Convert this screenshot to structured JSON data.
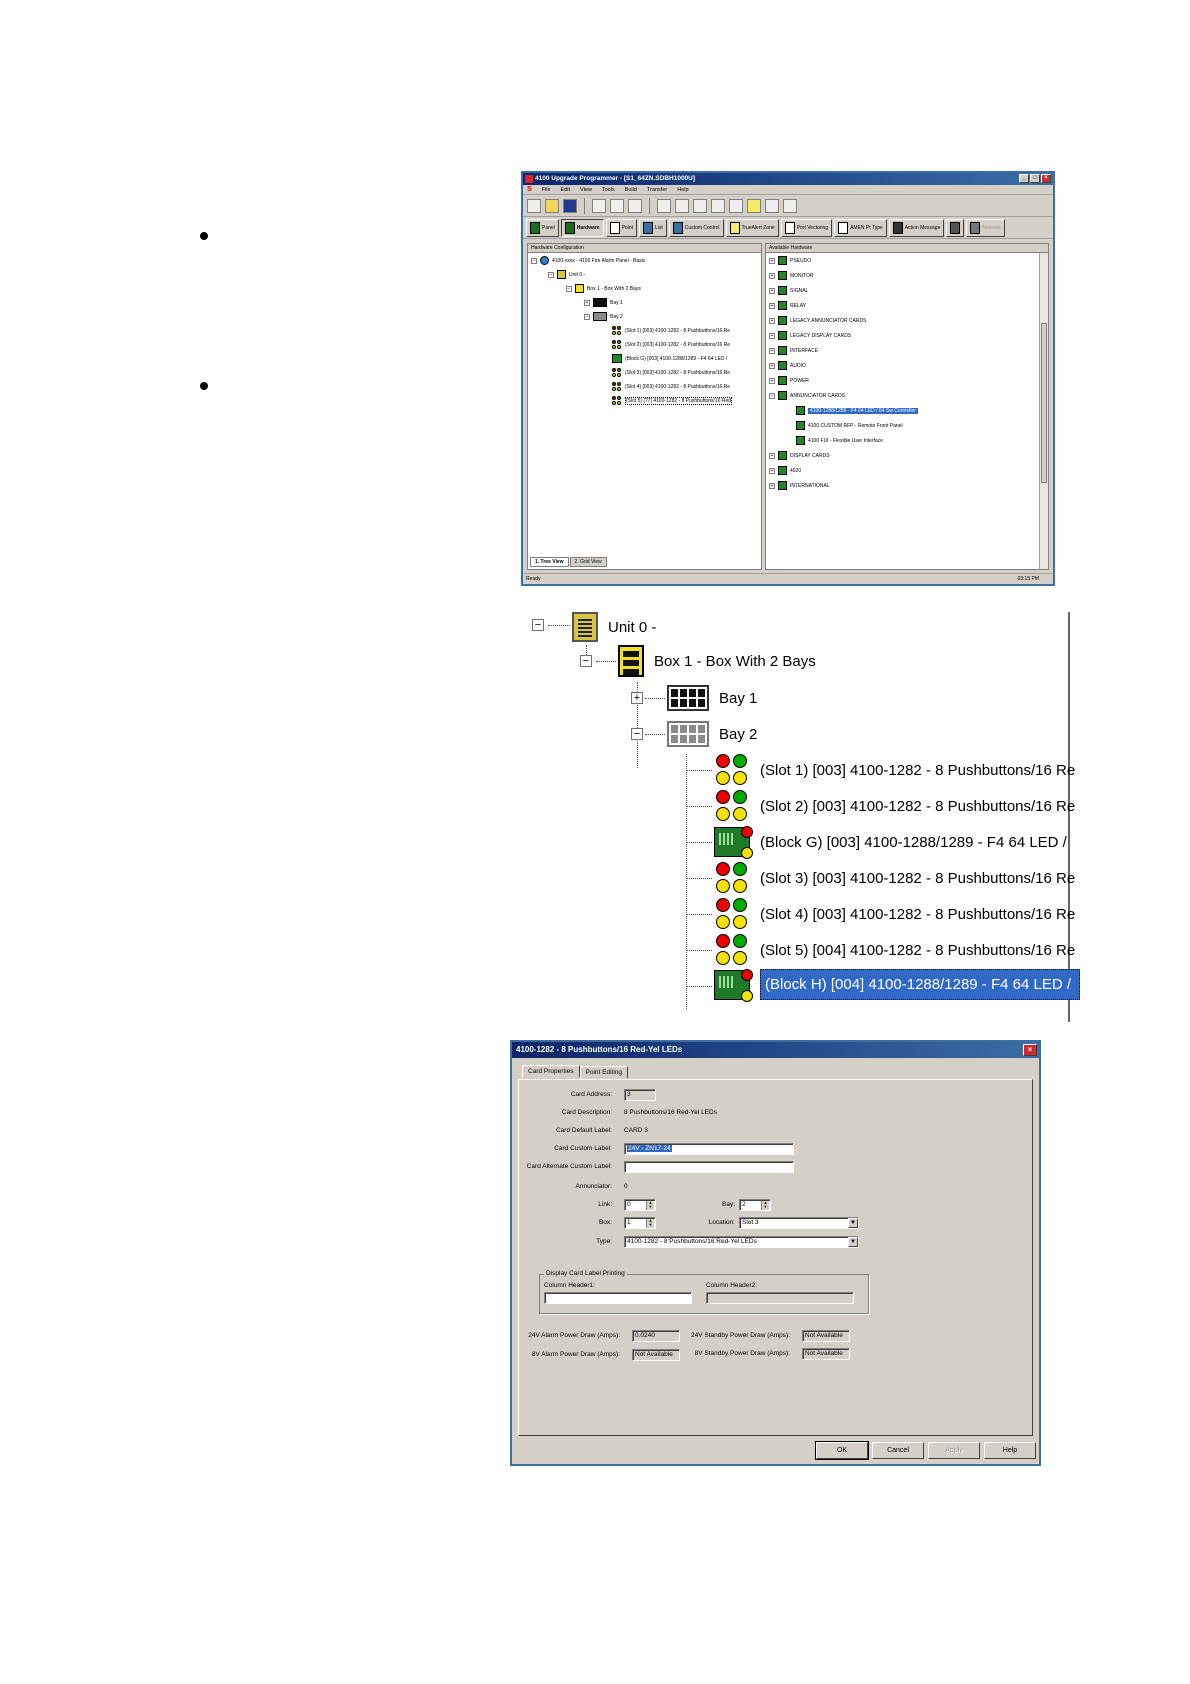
{
  "window": {
    "title": "4100 Upgrade Programmer - [S1_64ZN.SDBH1000U]",
    "menu": [
      "File",
      "Edit",
      "View",
      "Tools",
      "Build",
      "Transfer",
      "Help"
    ],
    "tabs": [
      "Panel",
      "Hardware",
      "Point",
      "List",
      "Custom Control",
      "TrueAlert Zone",
      "Port Vectoring",
      "AMEN Pt Type",
      "Action Message"
    ],
    "disabled_tab": "Network",
    "hw_header": "Hardware Configuration",
    "av_header": "Available Hardware",
    "hw_tree": {
      "root": "4100-xxxx - 4100 Fire Alarm Panel - Basic",
      "unit": "Unit 0 -",
      "box": "Box 1 - Box With 2 Bays",
      "bay1": "Bay 1",
      "bay2": "Bay 2",
      "slots": [
        "(Slot 1) [003] 4100-1282 - 8 Pushbuttons/16 Re",
        "(Slot 2) [003] 4100-1282 - 8 Pushbuttons/16 Re",
        "(Block G) [003] 4100-1288/1289 - F4 64 LED /",
        "(Slot 3) [003] 4100-1282 - 8 Pushbuttons/16 Re",
        "(Slot 4) [003] 4100-1282 - 8 Pushbuttons/16 Re",
        "(Slot 5) [?7] 4100-1282 - 8 Pushbuttons/16 Red"
      ]
    },
    "available": [
      "PSEUDO",
      "MONITOR",
      "SIGNAL",
      "RELAY",
      "LEGACY ANNUNCIATOR CARDS",
      "LEGACY DISPLAY CARDS",
      "INTERFACE",
      "AUDIO",
      "POWER",
      "ANNUNCIATOR CARDS"
    ],
    "available_children": [
      "4100-1288/1289 - F4 64 LED / 64 Sw Controller",
      "4100 CUSTOM RFP - Remote Front Panel",
      "4100 FUI - Flexible User Interface"
    ],
    "available_after": [
      "DISPLAY CARDS",
      "4020",
      "INTERNATIONAL"
    ],
    "view_tabs": [
      "1. Tree View",
      "2. Grid View"
    ],
    "status": "Ready",
    "clock": "03:15 PM"
  },
  "zoom_tree": {
    "unit": "Unit 0 -",
    "box": "Box 1 - Box With 2 Bays",
    "bay1": "Bay 1",
    "bay2": "Bay 2",
    "rows": [
      "(Slot 1) [003] 4100-1282 - 8 Pushbuttons/16 Re",
      "(Slot 2) [003] 4100-1282 - 8 Pushbuttons/16 Re",
      "(Block G) [003] 4100-1288/1289 - F4 64 LED /",
      "(Slot 3) [003] 4100-1282 - 8 Pushbuttons/16 Re",
      "(Slot 4) [003] 4100-1282 - 8 Pushbuttons/16 Re",
      "(Slot 5) [004] 4100-1282 - 8 Pushbuttons/16 Re",
      "(Block H) [004] 4100-1288/1289 - F4 64 LED /"
    ]
  },
  "dialog": {
    "title": "4100-1282 - 8 Pushbuttons/16 Red-Yel LEDs",
    "tabs": [
      "Card Properties",
      "Point Editing"
    ],
    "labels": {
      "card_address": "Card Address:",
      "card_description": "Card Description:",
      "card_default_label": "Card Default Label:",
      "card_custom_label": "Card Custom Label:",
      "card_alt_label": "Card Alternate Custom Label:",
      "annunciator": "Annunciator:",
      "link": "Link:",
      "bay": "Bay:",
      "box": "Box:",
      "location": "Location:",
      "type": "Type:",
      "printing_group": "Display Card Label Printing",
      "col1": "Column Header1:",
      "col2": "Column Header2:",
      "alarm24": "24V Alarm Power Draw (Amps):",
      "standby24": "24V Standby Power Draw (Amps):",
      "alarm8": "8V Alarm Power Draw (Amps):",
      "standby8": "8V Standby Power Draw (Amps):"
    },
    "values": {
      "card_address": "3",
      "card_description": "8 Pushbuttons/16 Red-Yel LEDs",
      "card_default_label": "CARD 3",
      "card_custom_label": "24V - ZN17-24",
      "card_alt_label": "",
      "annunciator": "0",
      "link": "0",
      "bay": "2",
      "box": "1",
      "location": "Slot 3",
      "type": "4100-1282 - 8 Pushbuttons/16 Red-Yel LEDs",
      "col1": "",
      "col2": "",
      "alarm24": "0.0240",
      "standby24": "Not Available",
      "alarm8": "Not Available",
      "standby8": "Not Available"
    },
    "buttons": {
      "ok": "OK",
      "cancel": "Cancel",
      "apply": "Apply",
      "help": "Help"
    }
  }
}
